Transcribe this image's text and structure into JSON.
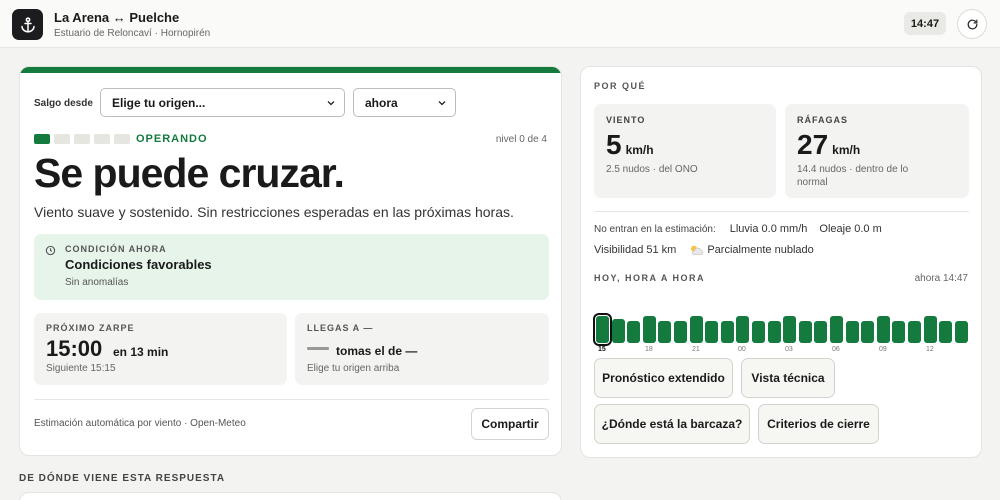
{
  "header": {
    "title": "La Arena ↔ Puelche",
    "subtitle": "Estuario de Reloncaví · Hornopirén",
    "clock": "14:47",
    "app_icon": "anchor-icon",
    "refresh_icon": "refresh-icon"
  },
  "main": {
    "origin_label": "Salgo desde",
    "origin_select": "Elige tu origen...",
    "time_select": "ahora",
    "level": {
      "active": 1,
      "total": 5,
      "status": "OPERANDO",
      "text": "nivel 0 de 4"
    },
    "headline": "Se puede cruzar.",
    "summary": "Viento suave y sostenido. Sin restricciones esperadas en las próximas horas.",
    "condition": {
      "label": "CONDICIÓN AHORA",
      "title": "Condiciones favorables",
      "sub": "Sin anomalías"
    },
    "next": {
      "label": "PRÓXIMO ZARPE",
      "time": "15:00",
      "relative": "en 13 min",
      "sub": "Siguiente 15:15"
    },
    "arrive": {
      "label": "LLEGAS A —",
      "text": "tomas el de —",
      "sub": "Elige tu origen arriba"
    },
    "footer_note": "Estimación automática por viento · Open-Meteo",
    "share_label": "Compartir",
    "section_title": "DE DÓNDE VIENE ESTA RESPUESTA"
  },
  "why": {
    "label": "POR QUÉ",
    "wind": {
      "label": "VIENTO",
      "value": "5",
      "unit": "km/h",
      "sub": "2.5 nudos · del ONO"
    },
    "gust": {
      "label": "RÁFAGAS",
      "value": "27",
      "unit": "km/h",
      "sub1": "14.4 nudos · dentro de lo",
      "sub2": "normal"
    },
    "extra_label": "No entran en la estimación:",
    "rain": "Lluvia 0.0 mm/h",
    "swell": "Oleaje 0.0 m",
    "visibility": "Visibilidad 51 km",
    "sky": "Parcialmente nublado",
    "sky_icon": "partly-cloudy-icon",
    "hourly_label": "HOY, HORA A HORA",
    "hourly_now": "ahora 14:47",
    "hourly_levels": [
      0.95,
      0.85,
      0.8,
      0.95,
      0.8,
      0.8,
      0.95,
      0.8,
      0.8,
      0.95,
      0.8,
      0.8,
      0.95,
      0.8,
      0.8,
      0.95,
      0.8,
      0.8,
      0.95,
      0.8,
      0.8,
      0.95,
      0.8,
      0.8
    ],
    "hourly_ticks": [
      {
        "index": 0,
        "text": "15"
      },
      {
        "index": 3,
        "text": "18"
      },
      {
        "index": 6,
        "text": "21"
      },
      {
        "index": 9,
        "text": "00"
      },
      {
        "index": 12,
        "text": "03"
      },
      {
        "index": 15,
        "text": "06"
      },
      {
        "index": 18,
        "text": "09"
      },
      {
        "index": 21,
        "text": "12"
      }
    ],
    "bar_color": "#157a3e",
    "buttons": {
      "forecast": "Pronóstico extendido",
      "technical": "Vista técnica",
      "barge": "¿Dónde está la barcaza?",
      "criteria": "Criterios de cierre"
    }
  }
}
